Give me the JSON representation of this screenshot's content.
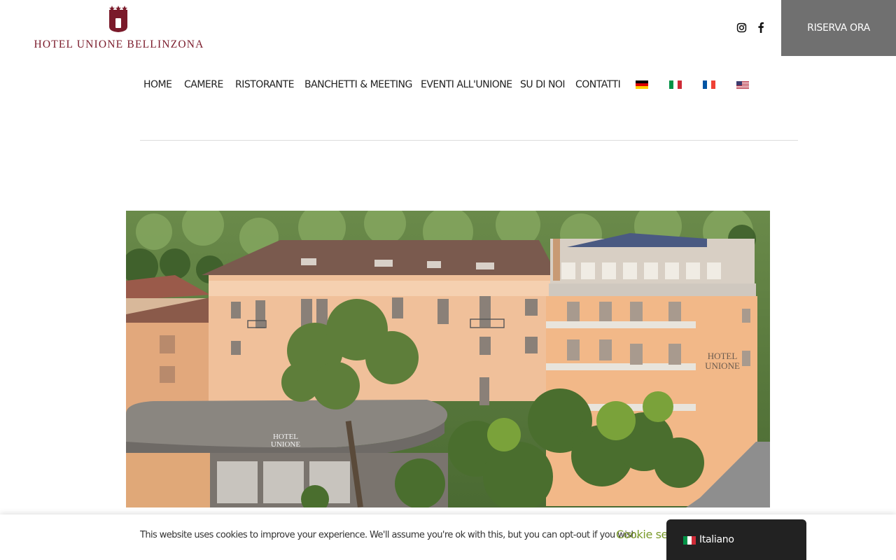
{
  "header": {
    "logo_text": "HOTEL UNIONE BELLINZONA",
    "reserve_label": "RISERVA ORA",
    "social": [
      "instagram-icon",
      "facebook-icon"
    ],
    "brand_color": "#7a1a2a",
    "reserve_bg": "#707070"
  },
  "nav": {
    "items": [
      "HOME",
      "CAMERE",
      "RISTORANTE",
      "BANCHETTI & MEETING",
      "EVENTI ALL'UNIONE",
      "SU DI NOI",
      "CONTATTI"
    ],
    "flags": [
      "flag-de",
      "flag-it",
      "flag-fr",
      "flag-us"
    ]
  },
  "cookie": {
    "text": "This website uses cookies to improve your experience. We'll assume you're ok with this, but you can opt-out if you wish.",
    "link": "Cookie set",
    "link_color": "#7a9a2a"
  },
  "language_switcher": {
    "label": "Italiano",
    "flag": "flag-it",
    "bg": "#222222"
  }
}
